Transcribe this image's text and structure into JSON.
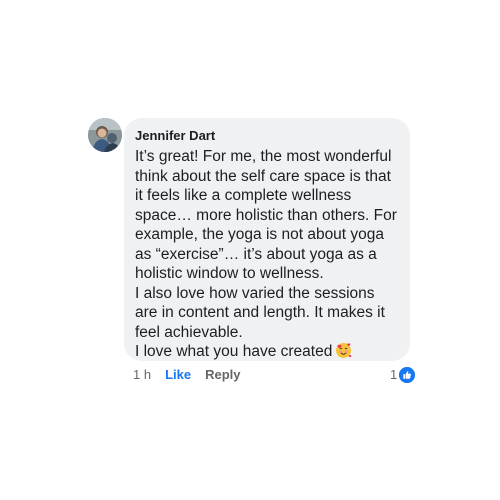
{
  "comment": {
    "author": "Jennifer Dart",
    "paragraphs": [
      "It’s great! For me, the most wonderful think about the self care space is that it feels like a complete wellness space… more holistic than others. For example, the yoga is not about yoga as “exercise”… it’s about yoga as a holistic window to wellness.",
      "I also love how varied the sessions are in content and length. It makes it feel achievable.",
      "I love what you have created"
    ],
    "emoji": "smiling-face-with-hearts-icon"
  },
  "actions": {
    "time": "1 h",
    "like_label": "Like",
    "reply_label": "Reply",
    "reaction_count": "1",
    "reaction_icon": "thumbs-up-icon"
  },
  "colors": {
    "bubble": "#eff1f3",
    "accent": "#1877f2",
    "secondary_text": "#65676b"
  }
}
